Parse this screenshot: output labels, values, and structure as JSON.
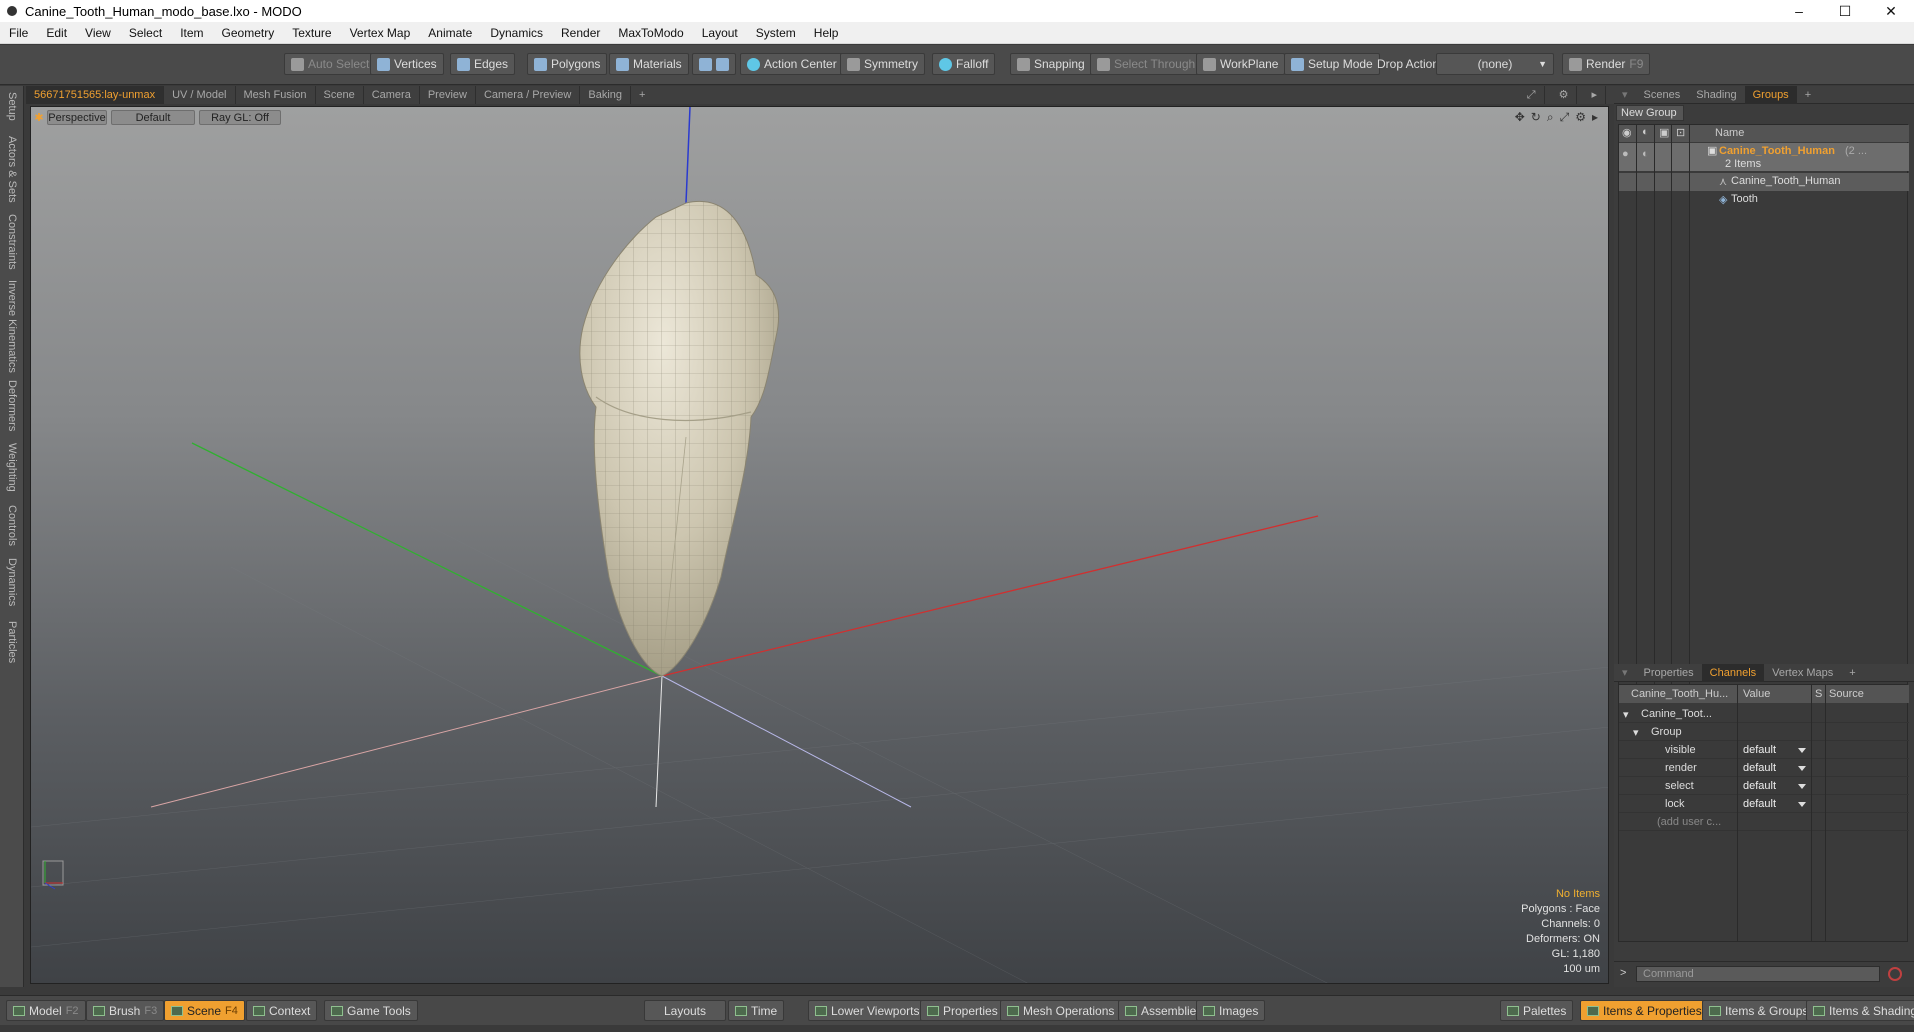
{
  "window": {
    "title": "Canine_Tooth_Human_modo_base.lxo - MODO",
    "minimize": "–",
    "maximize": "☐",
    "close": "✕"
  },
  "menu": [
    "File",
    "Edit",
    "View",
    "Select",
    "Item",
    "Geometry",
    "Texture",
    "Vertex Map",
    "Animate",
    "Dynamics",
    "Render",
    "MaxToModo",
    "Layout",
    "System",
    "Help"
  ],
  "toolbar": {
    "auto_select": "Auto Select",
    "vertices": "Vertices",
    "edges": "Edges",
    "polygons": "Polygons",
    "materials": "Materials",
    "action_center": "Action Center",
    "symmetry": "Symmetry",
    "falloff": "Falloff",
    "snapping": "Snapping",
    "select_through": "Select Through",
    "workplane": "WorkPlane",
    "setup_mode": "Setup Mode",
    "drop_action": "Drop Action",
    "drop_action_value": "(none)",
    "render": "Render",
    "render_key": "F9"
  },
  "left_tabs": [
    "Setup",
    "Actors & Sets",
    "Constraints",
    "Inverse Kinematics",
    "Deformers",
    "Weighting",
    "Controls",
    "Dynamics",
    "Particles"
  ],
  "viewport_tabs": [
    "56671751565:lay-unmax",
    "UV / Model",
    "Mesh Fusion",
    "Scene",
    "Camera",
    "Preview",
    "Camera / Preview",
    "Baking",
    "+"
  ],
  "viewport": {
    "perspective": "Perspective",
    "default": "Default",
    "raygl": "Ray GL: Off",
    "stats": {
      "items": "No Items",
      "polygons": "Polygons : Face",
      "channels": "Channels: 0",
      "deformers": "Deformers: ON",
      "gl": "GL: 1,180",
      "scale": "100 um"
    }
  },
  "right_top_tabs": [
    "Scenes",
    "Shading",
    "Groups",
    "+"
  ],
  "groups": {
    "new_group": "New Group",
    "name_col": "Name",
    "group_name": "Canine_Tooth_Human",
    "group_suffix": "(2 ...",
    "group_count": "2 Items",
    "children": [
      "Canine_Tooth_Human",
      "Tooth"
    ]
  },
  "right_bottom_tabs": [
    "Properties",
    "Channels",
    "Vertex Maps",
    "+"
  ],
  "channels": {
    "col_name": "Canine_Tooth_Hu...",
    "col_value": "Value",
    "col_s": "S",
    "col_source": "Source",
    "root": "Canine_Toot...",
    "group": "Group",
    "rows": [
      {
        "name": "visible",
        "value": "default"
      },
      {
        "name": "render",
        "value": "default"
      },
      {
        "name": "select",
        "value": "default"
      },
      {
        "name": "lock",
        "value": "default"
      }
    ],
    "add_user": "(add user c..."
  },
  "command_placeholder": "Command",
  "bottom_left": [
    {
      "label": "Model",
      "key": "F2"
    },
    {
      "label": "Brush",
      "key": "F3"
    },
    {
      "label": "Scene",
      "key": "F4"
    },
    {
      "label": "Context",
      "key": ""
    },
    {
      "label": "Game Tools",
      "key": ""
    }
  ],
  "bottom_center": [
    "Layouts",
    "Time",
    "Lower Viewports",
    "Properties",
    "Mesh Operations",
    "Assemblies",
    "Images"
  ],
  "bottom_right": [
    "Palettes",
    "Items & Properties",
    "Items & Groups",
    "Items & Shading"
  ],
  "colors": {
    "accent": "#f0a030",
    "x_axis": "#d03030",
    "y_axis": "#30b030",
    "z_axis": "#3040d0"
  }
}
